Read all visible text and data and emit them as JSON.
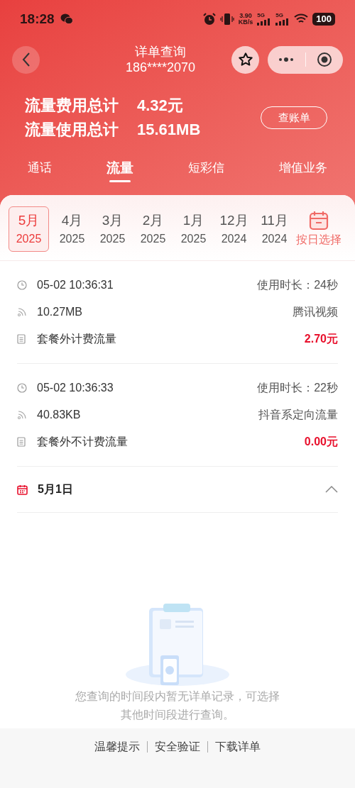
{
  "status_bar": {
    "time": "18:28",
    "speed": "3.90",
    "speed_unit": "KB/s",
    "signals": [
      "5G",
      "5G"
    ],
    "battery": "100"
  },
  "header": {
    "title": "详单查询",
    "subtitle": "186****2070"
  },
  "summary": [
    {
      "label": "流量费用总计",
      "value": "4.32元"
    },
    {
      "label": "流量使用总计",
      "value": "15.61MB"
    }
  ],
  "bill_button": "查账单",
  "tabs": [
    {
      "label": "通话",
      "selected": false
    },
    {
      "label": "流量",
      "selected": true
    },
    {
      "label": "短彩信",
      "selected": false
    },
    {
      "label": "增值业务",
      "selected": false
    }
  ],
  "months": [
    {
      "month": "5月",
      "year": "2025",
      "selected": true
    },
    {
      "month": "4月",
      "year": "2025",
      "selected": false
    },
    {
      "month": "3月",
      "year": "2025",
      "selected": false
    },
    {
      "month": "2月",
      "year": "2025",
      "selected": false
    },
    {
      "month": "1月",
      "year": "2025",
      "selected": false
    },
    {
      "month": "12月",
      "year": "2024",
      "selected": false
    },
    {
      "month": "11月",
      "year": "2024",
      "selected": false
    }
  ],
  "date_picker": "按日选择",
  "records": [
    {
      "time": "05-02 10:36:31",
      "duration": "使用时长：24秒",
      "usage": "10.27MB",
      "app": "腾讯视频",
      "type": "套餐外计费流量",
      "fee": "2.70元"
    },
    {
      "time": "05-02 10:36:33",
      "duration": "使用时长：22秒",
      "usage": "40.83KB",
      "app": "抖音系定向流量",
      "type": "套餐外不计费流量",
      "fee": "0.00元"
    }
  ],
  "day_group": {
    "date": "5月1日",
    "expanded": true
  },
  "empty": {
    "message": "您查询的时间段内暂无详单记录，可选择其他时间段进行查询。"
  },
  "footer_links": [
    "温馨提示",
    "安全验证",
    "下载详单"
  ]
}
